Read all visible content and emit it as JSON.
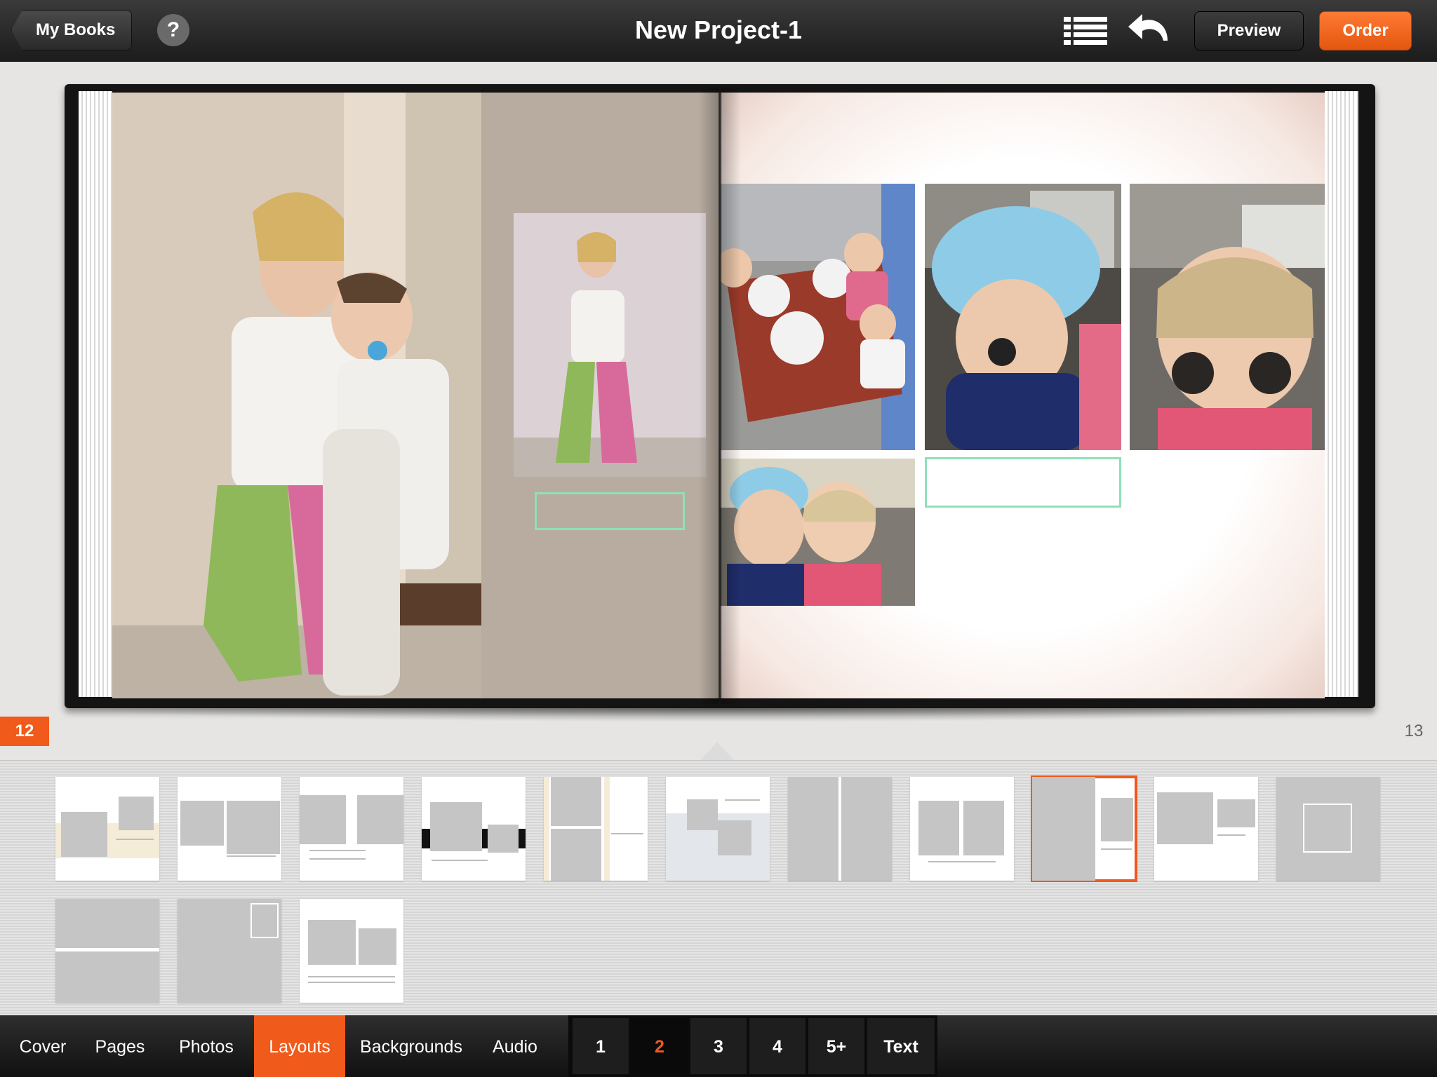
{
  "header": {
    "back_label": "My Books",
    "help_label": "?",
    "title": "New Project-1",
    "preview_label": "Preview",
    "order_label": "Order"
  },
  "book": {
    "left_page_number": "12",
    "right_page_number": "13"
  },
  "layouts": {
    "count": 14,
    "selected_index": 8
  },
  "bottom_tabs": {
    "items": [
      "Cover",
      "Pages",
      "Photos",
      "Layouts",
      "Backgrounds",
      "Audio"
    ],
    "active": "Layouts"
  },
  "photo_count": {
    "items": [
      "1",
      "2",
      "3",
      "4",
      "5+",
      "Text"
    ],
    "active": "2"
  },
  "colors": {
    "accent": "#f05a1a",
    "caption_outline": "#8fe0b8"
  }
}
